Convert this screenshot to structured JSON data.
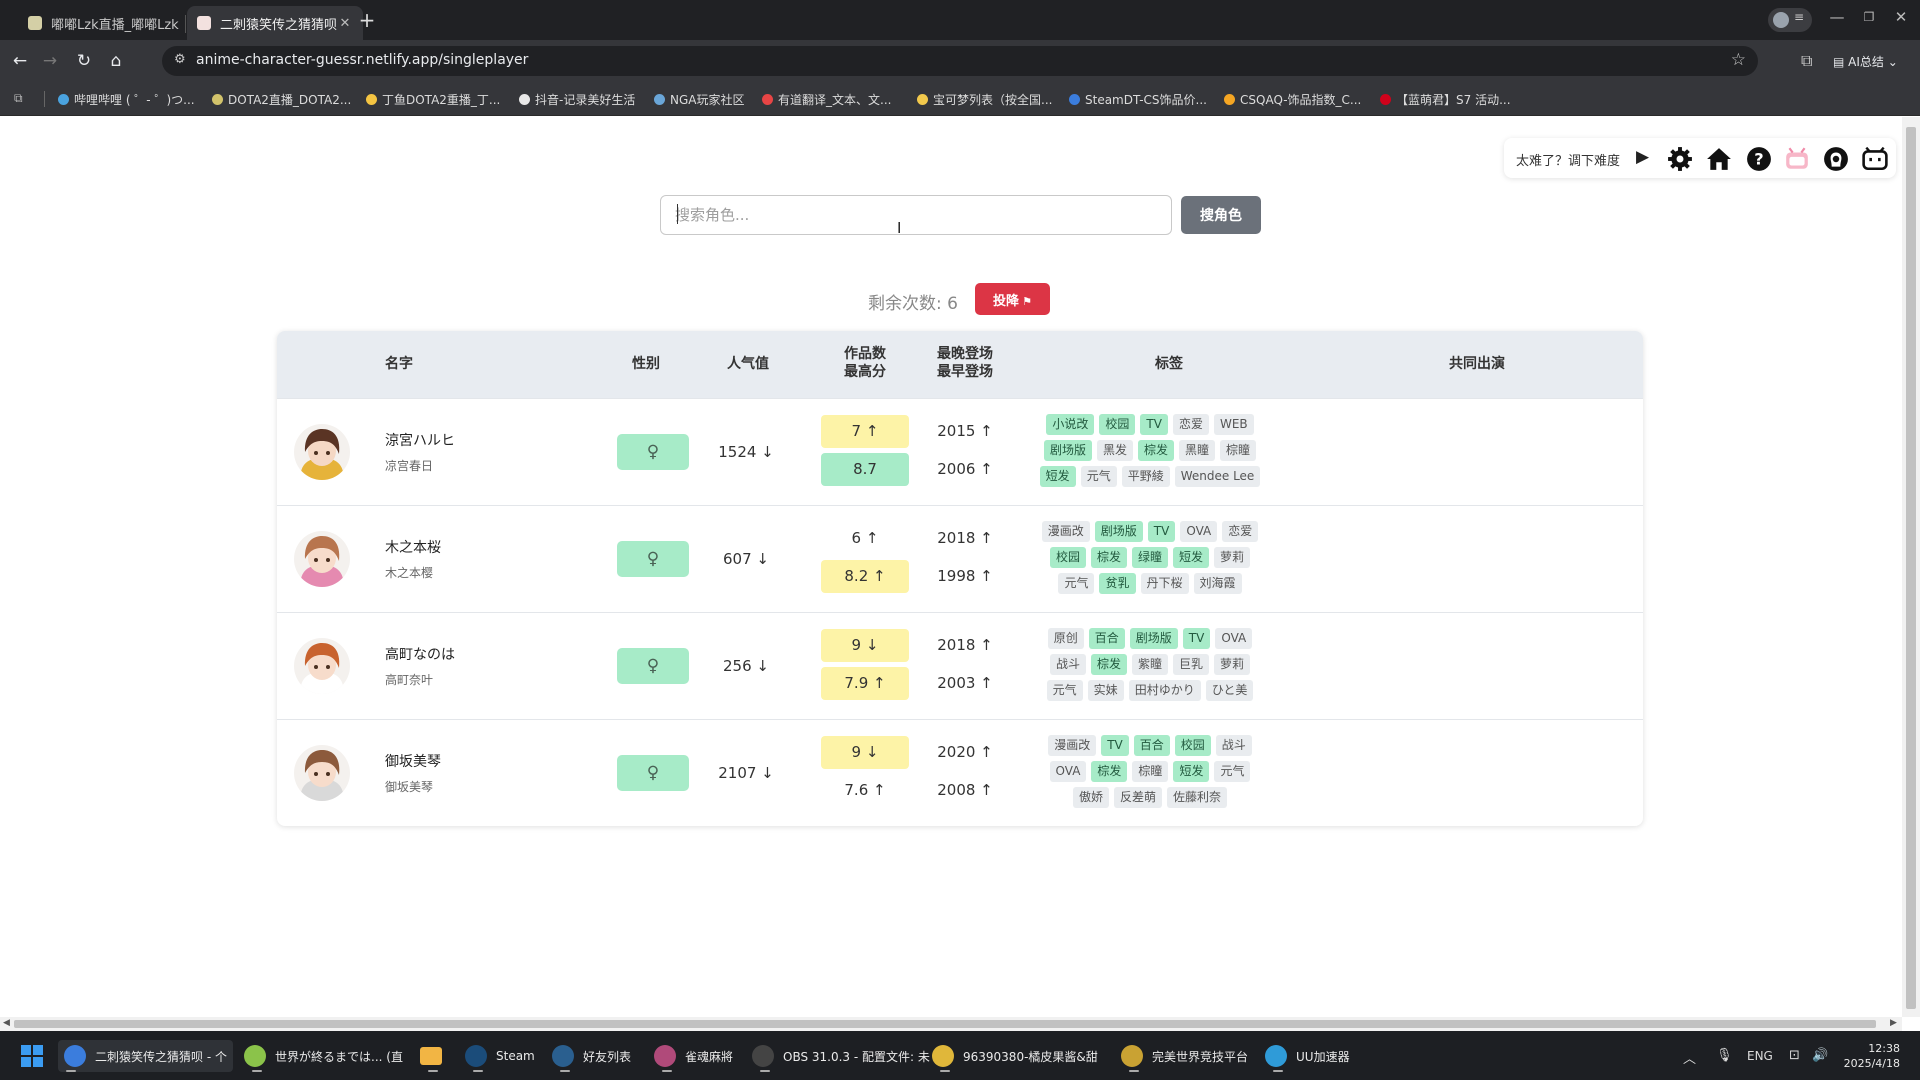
{
  "browser": {
    "tabs": [
      {
        "title": "嘟嘟Lzk直播_嘟嘟Lzk",
        "favicon_color": "#d4cfa6"
      },
      {
        "title": "二刺猿笑传之猜猜呗",
        "favicon_color": "#f3e1df"
      }
    ],
    "new_tab_glyph": "+",
    "url": "anime-character-guessr.netlify.app/singleplayer",
    "ai_label": "AI总结",
    "bookmarks": [
      {
        "label": "哔哩哔哩 ( ゜- ゜)つ...",
        "color": "#4aa3df"
      },
      {
        "label": "DOTA2直播_DOTA2...",
        "color": "#d2c36b"
      },
      {
        "label": "丁鱼DOTA2重播_丁...",
        "color": "#f5c542"
      },
      {
        "label": "抖音-记录美好生活",
        "color": "#e8e8e8"
      },
      {
        "label": "NGA玩家社区",
        "color": "#6aa6d8"
      },
      {
        "label": "有道翻译_文本、文...",
        "color": "#e84545"
      },
      {
        "label": "宝可梦列表（按全国...",
        "color": "#f2c94c"
      },
      {
        "label": "SteamDT-CS饰品价...",
        "color": "#3b7ddd"
      },
      {
        "label": "CSQAQ-饰品指数_C...",
        "color": "#f5a623"
      },
      {
        "label": "【蓝萌君】S7 活动...",
        "color": "#d0021b"
      }
    ]
  },
  "controls": {
    "hint": "太难了？调下难度",
    "icons": [
      "settings-icon",
      "home-icon",
      "help-icon",
      "bangumi-icon",
      "github-icon",
      "bilibili-icon"
    ]
  },
  "search": {
    "placeholder": "搜索角色...",
    "button_label": "搜角色"
  },
  "status": {
    "remaining": "剩余次数: 6",
    "surrender_label": "投降",
    "surrender_icon": "flag-icon"
  },
  "table": {
    "headers": {
      "name": "名字",
      "gender": "性别",
      "popularity": "人气值",
      "works": "作品数",
      "top_score": "最高分",
      "latest": "最晚登场",
      "earliest": "最早登场",
      "tags": "标签",
      "shared": "共同出演"
    },
    "rows": [
      {
        "name": "涼宮ハルヒ",
        "subname": "凉宫春日",
        "gender": "♀",
        "gender_color": "#a7ebc8",
        "popularity": "1524 ↓",
        "works": "7 ↑",
        "works_color": "#fdf3a7",
        "score": "8.7",
        "score_color": "#a7ebc8",
        "latest": "2015 ↑",
        "earliest": "2006 ↑",
        "avatar": {
          "hair": "#5a3424",
          "skin": "#f5d8c4",
          "accent": "#e6b33a"
        },
        "tags": [
          {
            "text": "小说改",
            "hl": true
          },
          {
            "text": "校园",
            "hl": true
          },
          {
            "text": "TV",
            "hl": true
          },
          {
            "text": "恋爱",
            "hl": false
          },
          {
            "text": "WEB",
            "hl": false
          },
          {
            "text": "剧场版",
            "hl": true
          },
          {
            "text": "黑发",
            "hl": false
          },
          {
            "text": "棕发",
            "hl": true
          },
          {
            "text": "黑瞳",
            "hl": false
          },
          {
            "text": "棕瞳",
            "hl": false
          },
          {
            "text": "短发",
            "hl": true
          },
          {
            "text": "元气",
            "hl": false
          },
          {
            "text": "平野綾",
            "hl": false
          },
          {
            "text": "Wendee Lee",
            "hl": false
          }
        ]
      },
      {
        "name": "木之本桜",
        "subname": "木之本樱",
        "gender": "♀",
        "gender_color": "#a7ebc8",
        "popularity": "607 ↓",
        "works": "6 ↑",
        "works_color": "",
        "score": "8.2 ↑",
        "score_color": "#fdf3a7",
        "latest": "2018 ↑",
        "earliest": "1998 ↑",
        "avatar": {
          "hair": "#b8754e",
          "skin": "#f7dccb",
          "accent": "#e58ab0"
        },
        "tags": [
          {
            "text": "漫画改",
            "hl": false
          },
          {
            "text": "剧场版",
            "hl": true
          },
          {
            "text": "TV",
            "hl": true
          },
          {
            "text": "OVA",
            "hl": false
          },
          {
            "text": "恋爱",
            "hl": false
          },
          {
            "text": "校园",
            "hl": true
          },
          {
            "text": "棕发",
            "hl": true
          },
          {
            "text": "绿瞳",
            "hl": true
          },
          {
            "text": "短发",
            "hl": true
          },
          {
            "text": "萝莉",
            "hl": false
          },
          {
            "text": "元气",
            "hl": false
          },
          {
            "text": "贫乳",
            "hl": true
          },
          {
            "text": "丹下桜",
            "hl": false
          },
          {
            "text": "刘海霞",
            "hl": false
          }
        ]
      },
      {
        "name": "高町なのは",
        "subname": "高町奈叶",
        "gender": "♀",
        "gender_color": "#a7ebc8",
        "popularity": "256 ↓",
        "works": "9 ↓",
        "works_color": "#fdf3a7",
        "score": "7.9 ↑",
        "score_color": "#fdf3a7",
        "latest": "2018 ↑",
        "earliest": "2003 ↑",
        "avatar": {
          "hair": "#c8622e",
          "skin": "#f7dccb",
          "accent": "#ffffff"
        },
        "tags": [
          {
            "text": "原创",
            "hl": false
          },
          {
            "text": "百合",
            "hl": true
          },
          {
            "text": "剧场版",
            "hl": true
          },
          {
            "text": "TV",
            "hl": true
          },
          {
            "text": "OVA",
            "hl": false
          },
          {
            "text": "战斗",
            "hl": false
          },
          {
            "text": "棕发",
            "hl": true
          },
          {
            "text": "紫瞳",
            "hl": false
          },
          {
            "text": "巨乳",
            "hl": false
          },
          {
            "text": "萝莉",
            "hl": false
          },
          {
            "text": "元气",
            "hl": false
          },
          {
            "text": "实妹",
            "hl": false
          },
          {
            "text": "田村ゆかり",
            "hl": false
          },
          {
            "text": "ひと美",
            "hl": false
          }
        ]
      },
      {
        "name": "御坂美琴",
        "subname": "御坂美琴",
        "gender": "♀",
        "gender_color": "#a7ebc8",
        "popularity": "2107 ↓",
        "works": "9 ↓",
        "works_color": "#fdf3a7",
        "score": "7.6 ↑",
        "score_color": "",
        "latest": "2020 ↑",
        "earliest": "2008 ↑",
        "avatar": {
          "hair": "#8c5a3c",
          "skin": "#f7dccb",
          "accent": "#d9d9d9"
        },
        "tags": [
          {
            "text": "漫画改",
            "hl": false
          },
          {
            "text": "TV",
            "hl": true
          },
          {
            "text": "百合",
            "hl": true
          },
          {
            "text": "校园",
            "hl": true
          },
          {
            "text": "战斗",
            "hl": false
          },
          {
            "text": "OVA",
            "hl": false
          },
          {
            "text": "棕发",
            "hl": true
          },
          {
            "text": "棕瞳",
            "hl": false
          },
          {
            "text": "短发",
            "hl": true
          },
          {
            "text": "元气",
            "hl": false
          },
          {
            "text": "傲娇",
            "hl": false
          },
          {
            "text": "反差萌",
            "hl": false
          },
          {
            "text": "佐藤利奈",
            "hl": false
          }
        ]
      }
    ]
  },
  "taskbar": {
    "apps": [
      {
        "label": "二刺猿笑传之猜猜呗 - 个",
        "color": "#3b7ddd",
        "active": true
      },
      {
        "label": "世界が終るまでは... (直",
        "color": "#8bc34a",
        "active": false
      },
      {
        "label": "",
        "color": "#f2b544",
        "active": false,
        "square": true
      },
      {
        "label": "Steam",
        "color": "#1b4c7a",
        "active": false
      },
      {
        "label": "好友列表",
        "color": "#2a5f8f",
        "active": false
      },
      {
        "label": "雀魂麻將",
        "color": "#b04a7a",
        "active": false
      },
      {
        "label": "OBS 31.0.3 - 配置文件: 未",
        "color": "#444444",
        "active": false
      },
      {
        "label": "96390380-橘皮果酱&甜",
        "color": "#e0b73a",
        "active": false
      },
      {
        "label": "完美世界竞技平台",
        "color": "#c9a233",
        "active": false
      },
      {
        "label": "UU加速器",
        "color": "#2f9bd8",
        "active": false
      }
    ],
    "tray_lang": "ENG",
    "time": "12:38",
    "date": "2025/4/18"
  }
}
